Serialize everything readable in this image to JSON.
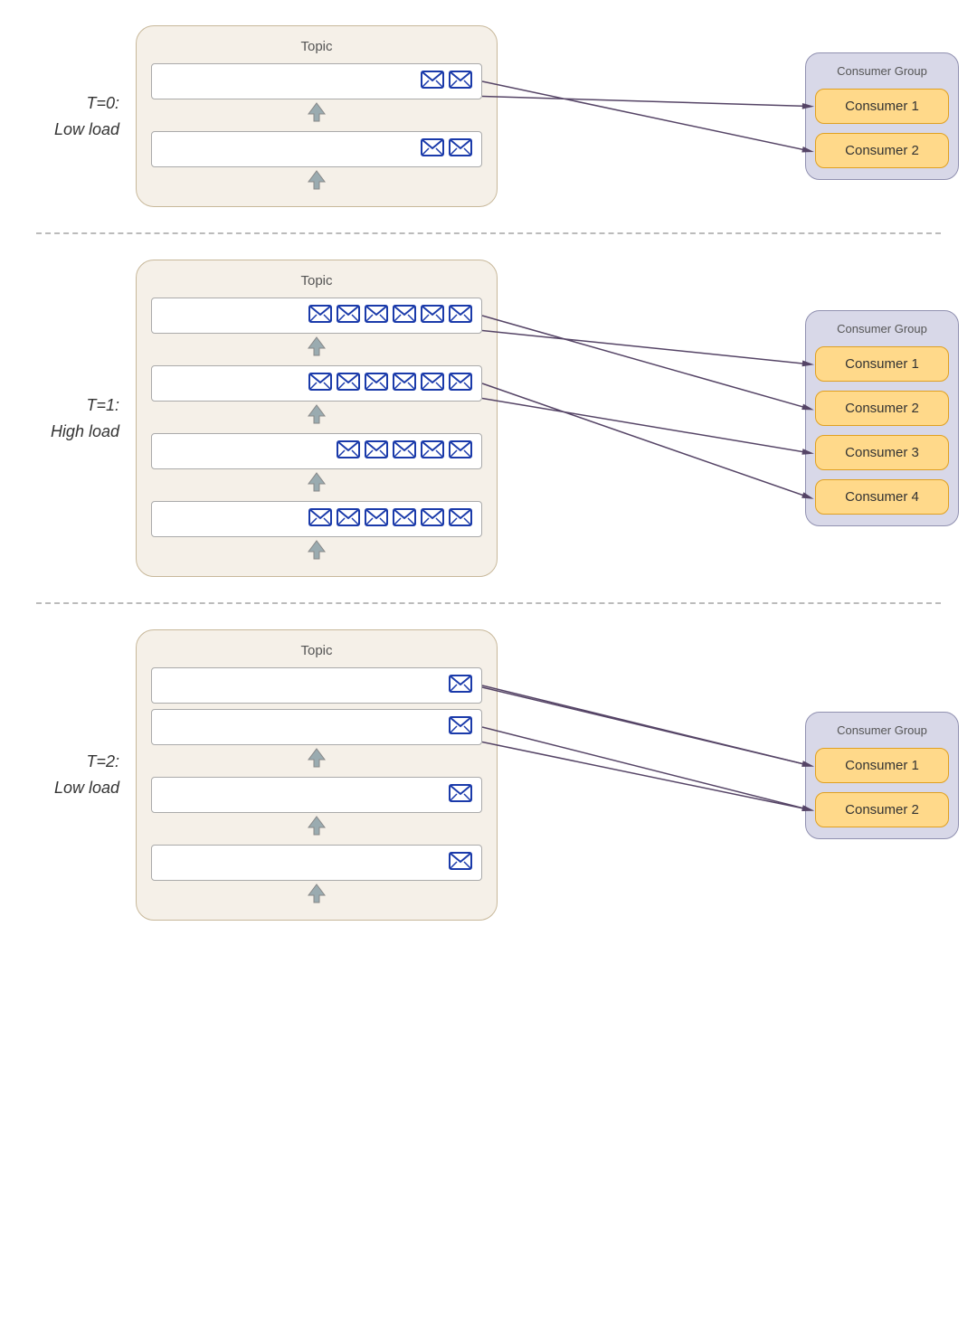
{
  "sections": [
    {
      "id": "s1",
      "label_line1": "T=0:",
      "label_line2": "Low load",
      "topic_label": "Topic",
      "partitions": [
        {
          "messages": 2,
          "has_arrow": true
        },
        {
          "messages": 2,
          "has_arrow": true
        }
      ],
      "consumer_group_label": "Consumer Group",
      "consumers": [
        "Consumer 1",
        "Consumer 2"
      ],
      "connections": [
        [
          0,
          0
        ],
        [
          1,
          1
        ]
      ]
    },
    {
      "id": "s2",
      "label_line1": "T=1:",
      "label_line2": "High load",
      "topic_label": "Topic",
      "partitions": [
        {
          "messages": 6,
          "has_arrow": true
        },
        {
          "messages": 6,
          "has_arrow": true
        },
        {
          "messages": 5,
          "has_arrow": true
        },
        {
          "messages": 6,
          "has_arrow": true
        }
      ],
      "consumer_group_label": "Consumer Group",
      "consumers": [
        "Consumer 1",
        "Consumer 2",
        "Consumer 3",
        "Consumer 4"
      ],
      "connections": [
        [
          0,
          0
        ],
        [
          1,
          1
        ],
        [
          2,
          2
        ],
        [
          3,
          3
        ]
      ]
    },
    {
      "id": "s3",
      "label_line1": "T=2:",
      "label_line2": "Low load",
      "topic_label": "Topic",
      "partitions": [
        {
          "messages": 1,
          "has_arrow": false
        },
        {
          "messages": 1,
          "has_arrow": true
        },
        {
          "messages": 1,
          "has_arrow": true
        },
        {
          "messages": 1,
          "has_arrow": true
        }
      ],
      "consumer_group_label": "Consumer Group",
      "consumers": [
        "Consumer 1",
        "Consumer 2"
      ],
      "connections": [
        [
          0,
          0
        ],
        [
          1,
          0
        ],
        [
          2,
          1
        ],
        [
          3,
          1
        ]
      ]
    }
  ],
  "icons": {
    "email": "✉"
  }
}
